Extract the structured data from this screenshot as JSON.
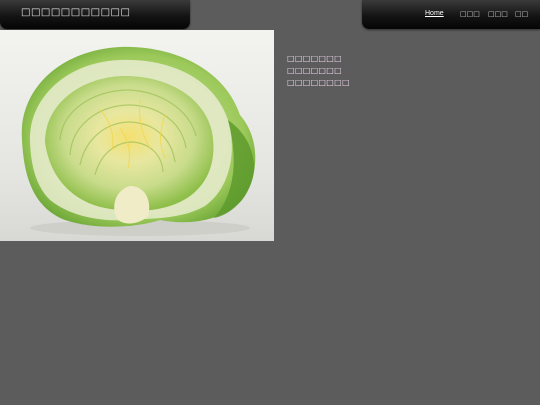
{
  "header": {
    "site_title": "□□□□□□□□□□□"
  },
  "nav": {
    "items": [
      {
        "label": "Home",
        "active": true
      },
      {
        "label": "□□□",
        "active": false
      },
      {
        "label": "□□□",
        "active": false
      },
      {
        "label": "□□",
        "active": false
      }
    ]
  },
  "main": {
    "image_icon": "cabbage-photo"
  },
  "sidebar": {
    "links": [
      {
        "label": "□□□□□□□"
      },
      {
        "label": "□□□□□□□"
      },
      {
        "label": "□□□□□□□□"
      }
    ]
  },
  "colors": {
    "background": "#5c5c5c",
    "header": "#141414",
    "link": "#f0d8ef"
  }
}
